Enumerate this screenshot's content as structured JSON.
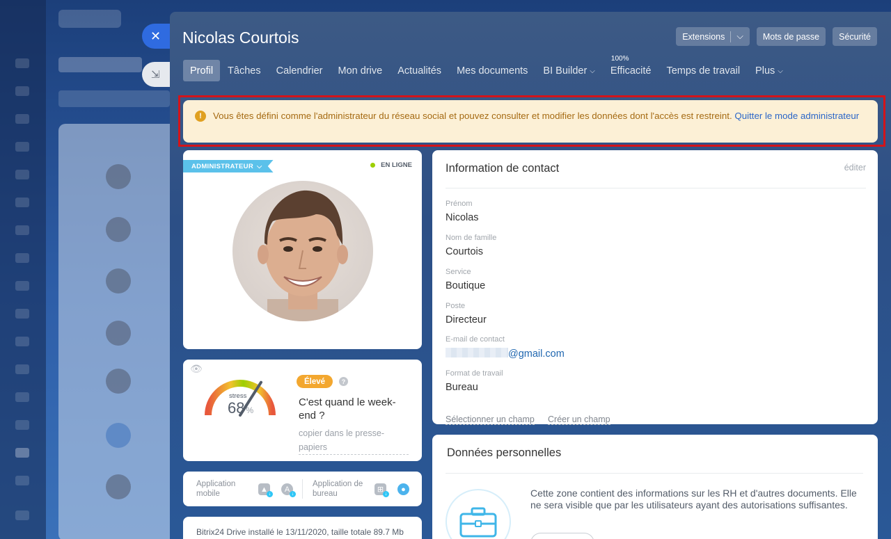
{
  "panel": {
    "title": "Nicolas Courtois",
    "header_buttons": {
      "extensions": "Extensions",
      "passwords": "Mots de passe",
      "security": "Sécurité"
    },
    "tabs": [
      {
        "label": "Profil",
        "active": true
      },
      {
        "label": "Tâches"
      },
      {
        "label": "Calendrier"
      },
      {
        "label": "Mon drive"
      },
      {
        "label": "Actualités"
      },
      {
        "label": "Mes documents"
      },
      {
        "label": "BI Builder",
        "dropdown": true
      },
      {
        "label": "Efficacité",
        "badge": "100%"
      },
      {
        "label": "Temps de travail"
      },
      {
        "label": "Plus",
        "dropdown": true
      }
    ]
  },
  "alert": {
    "text": "Vous êtes défini comme l'administrateur du réseau social et pouvez consulter et modifier les données dont l'accès est restreint.",
    "link": "Quitter le mode administrateur"
  },
  "profile": {
    "role_tag": "ADMINISTRATEUR",
    "status": "EN LIGNE"
  },
  "stress": {
    "label": "stress",
    "value": "68",
    "unit": "%",
    "level_fraction": 0.68,
    "level": "Élevé",
    "quote": "C'est quand le week-end ?",
    "copy_link": "copier dans le presse-papiers"
  },
  "apps": {
    "mobile": "Application mobile",
    "desktop": "Application de bureau"
  },
  "drive": {
    "text": "Bitrix24 Drive installé le 13/11/2020, taille totale 89.7 Mb"
  },
  "contact": {
    "title": "Information de contact",
    "edit": "éditer",
    "fields": [
      {
        "label": "Prénom",
        "value": "Nicolas"
      },
      {
        "label": "Nom de famille",
        "value": "Courtois"
      },
      {
        "label": "Service",
        "value": "Boutique"
      },
      {
        "label": "Poste",
        "value": "Directeur"
      },
      {
        "label": "E-mail de contact",
        "value": "@gmail.com"
      },
      {
        "label": "Format de travail",
        "value": "Bureau"
      }
    ],
    "select_field": "Sélectionner un champ",
    "create_field": "Créer un champ"
  },
  "personal": {
    "title": "Données personnelles",
    "text": "Cette zone contient des informations sur les RH et d'autres documents. Elle ne sera visible que par les utilisateurs ayant des autorisations suffisantes."
  },
  "colors": {
    "accent_blue": "#2f6be0",
    "alert_bg": "#fcf0d6",
    "alert_text": "#a56a12",
    "highlight_frame": "#d3141a",
    "online_green": "#9dcf00",
    "level_high": "#f3a72f",
    "admin_tag": "#5bc1ea"
  }
}
